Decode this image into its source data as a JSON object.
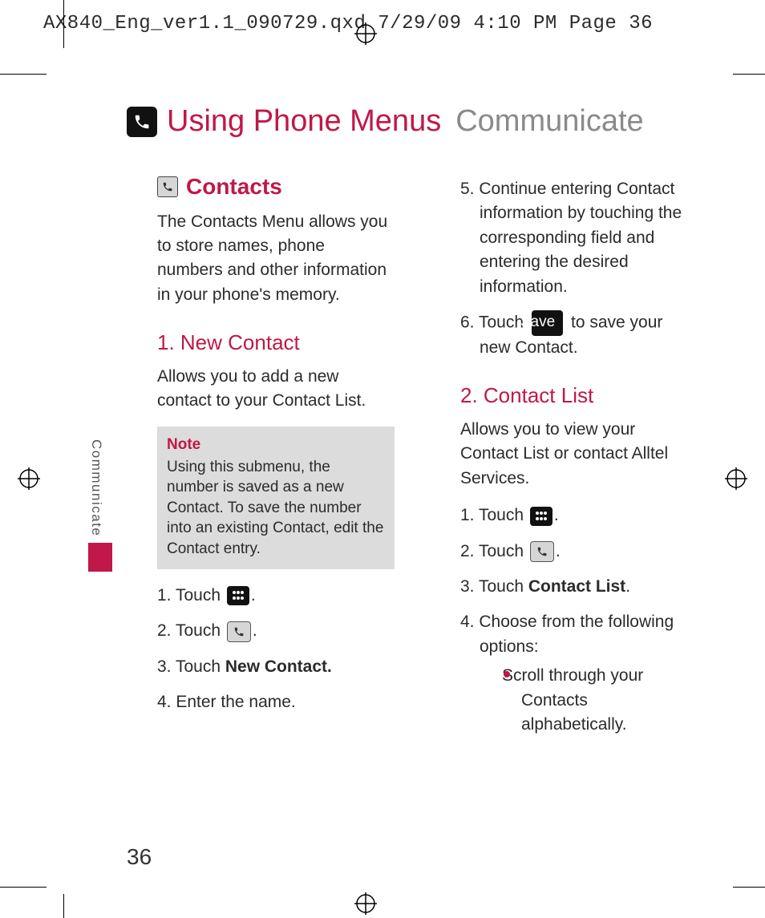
{
  "printer_header": "AX840_Eng_ver1.1_090729.qxd  7/29/09  4:10 PM  Page 36",
  "title": {
    "main": "Using Phone Menus",
    "sub": "Communicate"
  },
  "side_tab": "Communicate",
  "page_number": "36",
  "left": {
    "section_heading": "Contacts",
    "section_intro": "The Contacts Menu allows you to store names, phone numbers and other information in your phone's memory.",
    "sub1_heading": "1. New Contact",
    "sub1_intro": "Allows you to add a new contact to your Contact List.",
    "note_label": "Note",
    "note_body": "Using this submenu, the number is saved as a new Contact. To save the number into an existing Contact, edit the Contact entry.",
    "steps": {
      "s1_a": "1. Touch ",
      "s1_b": ".",
      "s2_a": "2. Touch ",
      "s2_b": ".",
      "s3_a": "3. Touch ",
      "s3_bold": "New Contact.",
      "s4": "4. Enter the name."
    }
  },
  "right": {
    "cont_steps": {
      "s5": "5. Continue entering Contact information by touching the corresponding field and entering the desired information.",
      "s6_a": "6. Touch ",
      "s6_save": "Save",
      "s6_b": " to save your new Contact."
    },
    "sub2_heading": "2. Contact List",
    "sub2_intro": "Allows you to view your Contact List or contact Alltel Services.",
    "steps": {
      "s1_a": "1. Touch ",
      "s1_b": ".",
      "s2_a": "2. Touch ",
      "s2_b": ".",
      "s3_a": "3. Touch ",
      "s3_bold": "Contact List",
      "s3_b": ".",
      "s4": "4. Choose from the following options:"
    },
    "bullet1": "Scroll through your Contacts alphabetically."
  }
}
